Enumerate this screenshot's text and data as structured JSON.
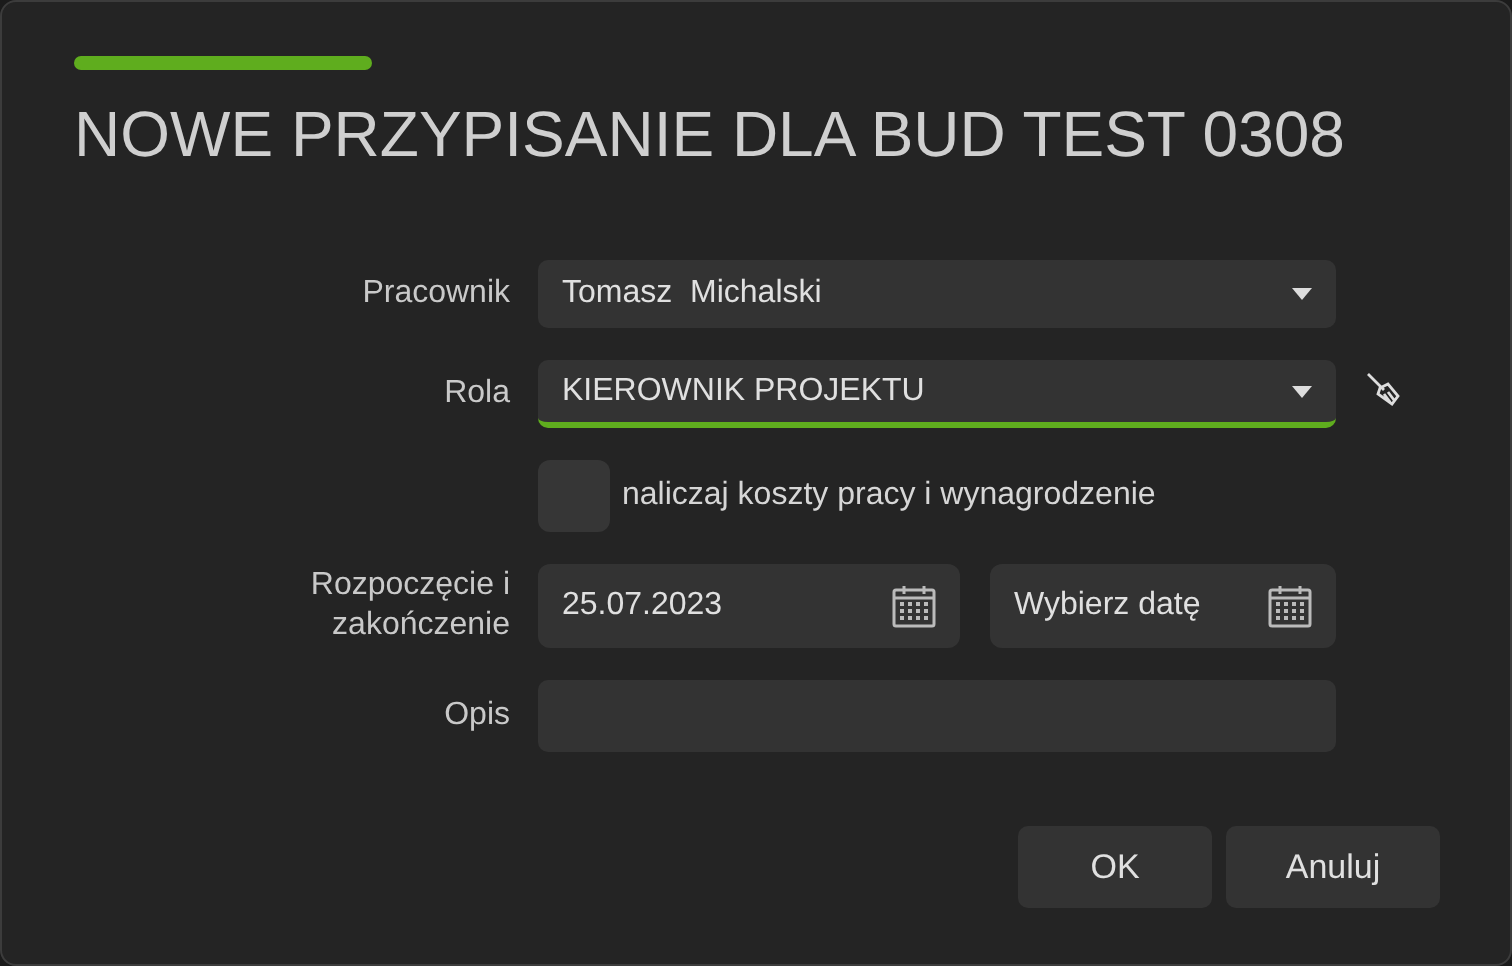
{
  "dialog": {
    "title": "NOWE PRZYPISANIE DLA BUD TEST 0308"
  },
  "fields": [
    {
      "kind": "select",
      "label": "Pracownik",
      "value": "Tomasz  Michalski",
      "focused": false,
      "clear_icon": false
    },
    {
      "kind": "select",
      "label": "Rola",
      "value": "KIEROWNIK PROJEKTU",
      "focused": true,
      "clear_icon": true
    },
    {
      "kind": "checkbox",
      "text": "naliczaj koszty pracy i wynagrodzenie",
      "checked": false
    },
    {
      "kind": "daterange",
      "label": "Rozpoczęcie i zakończenie",
      "start": {
        "value": "25.07.2023"
      },
      "end": {
        "placeholder": "Wybierz datę"
      }
    },
    {
      "kind": "text",
      "label": "Opis"
    }
  ],
  "buttons": [
    "OK",
    "Anuluj"
  ]
}
